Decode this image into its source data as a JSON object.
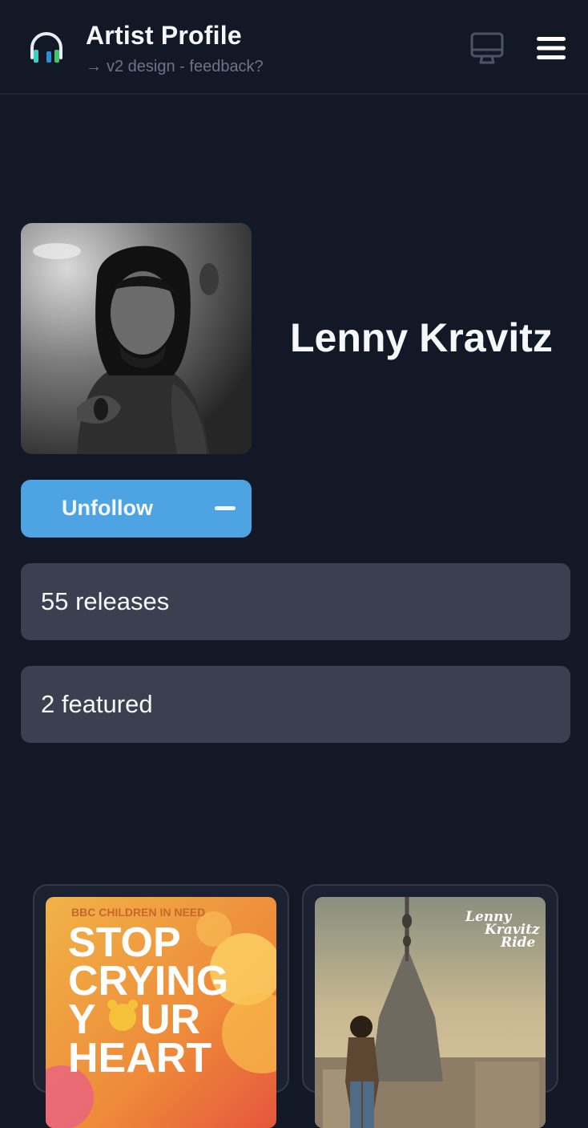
{
  "header": {
    "title": "Artist Profile",
    "subtitle": "v2 design - feedback?",
    "subtitle_arrow": "→",
    "logo_icon": "headphones-icon",
    "display_icon": "monitor-icon",
    "menu_icon": "hamburger-menu-icon"
  },
  "artist": {
    "name": "Lenny Kravitz",
    "photo_desc_icon": "artist-photo"
  },
  "actions": {
    "unfollow_label": "Unfollow"
  },
  "stats": {
    "releases": "55 releases",
    "featured": "2 featured"
  },
  "releases": [
    {
      "cover_lines": [
        "BBC CHILDREN IN NEED",
        "STOP",
        "CRYING",
        "Y",
        "UR",
        "HEART"
      ]
    },
    {
      "cover_lines": [
        "Lenny",
        "Kravitz",
        "Ride"
      ]
    }
  ],
  "colors": {
    "background": "#131826",
    "accent": "#4ea3e3",
    "stat_bg": "#3a404f",
    "logo_teal": "#3fd0c4",
    "logo_blue": "#2b8fd8",
    "logo_green": "#44c46e"
  }
}
